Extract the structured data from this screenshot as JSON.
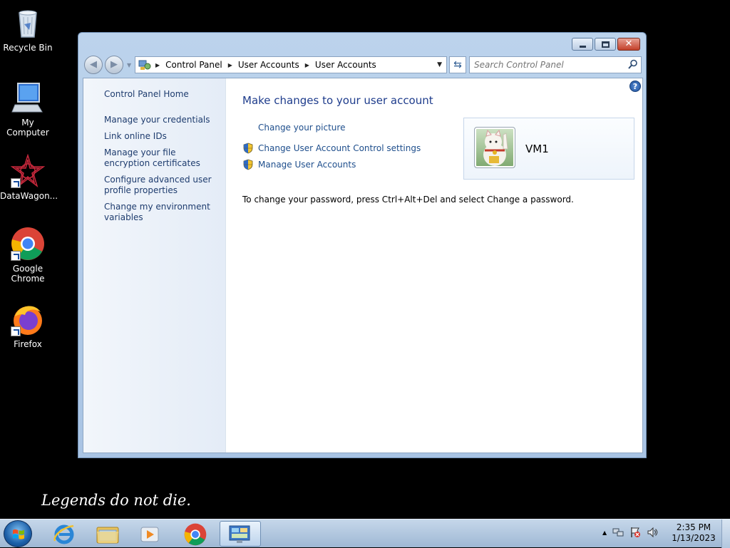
{
  "desktop": {
    "icons": [
      {
        "label": "Recycle Bin"
      },
      {
        "label": "My Computer"
      },
      {
        "label": "DataWagon..."
      },
      {
        "label": "Google Chrome"
      },
      {
        "label": "Firefox"
      }
    ],
    "motto": "Legends do not die."
  },
  "window": {
    "caption": {
      "minimize": "",
      "maximize": "",
      "close": "✕"
    },
    "breadcrumb": [
      "Control Panel",
      "User Accounts",
      "User Accounts"
    ],
    "search_placeholder": "Search Control Panel",
    "sidebar": {
      "home": "Control Panel Home",
      "tasks": [
        "Manage your credentials",
        "Link online IDs",
        "Manage your file encryption certificates",
        "Configure advanced user profile properties",
        "Change my environment variables"
      ]
    },
    "main": {
      "heading": "Make changes to your user account",
      "links": {
        "change_picture": "Change your picture",
        "uac_settings": "Change User Account Control settings",
        "manage_accounts": "Manage User Accounts"
      },
      "note": "To change your password, press Ctrl+Alt+Del and select Change a password.",
      "user": {
        "name": "VM1"
      },
      "help": "?"
    }
  },
  "taskbar": {
    "clock": {
      "time": "2:35 PM",
      "date": "1/13/2023"
    },
    "tray_arrow": "▲"
  },
  "colors": {
    "link": "#1e4e8c",
    "heading": "#1e3c8c",
    "window_frame": "#a9c4e4"
  }
}
